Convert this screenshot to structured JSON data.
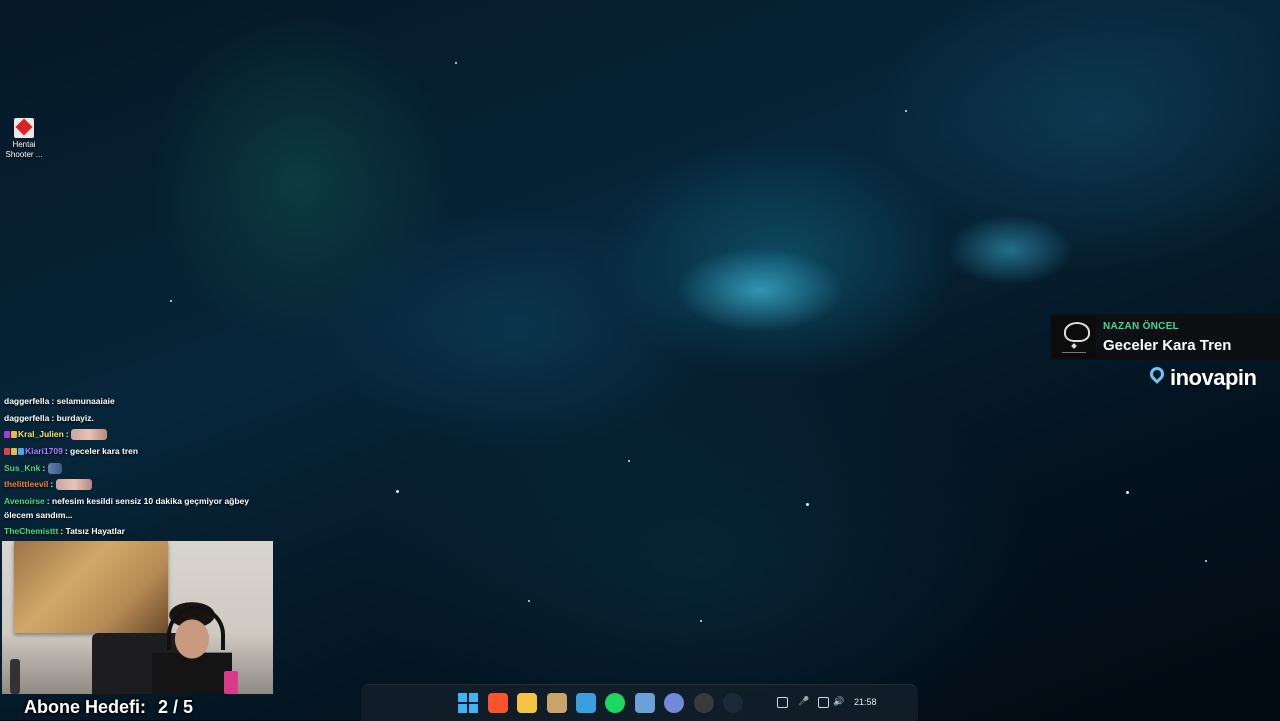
{
  "desktop": {
    "icons": [
      {
        "label": "Hentai Shooter ...",
        "icon": "game-shortcut-icon"
      }
    ]
  },
  "chat": {
    "messages": [
      {
        "user": "daggerfella",
        "user_color": "#ffffff",
        "text": "selamunaaiaie",
        "badges": [],
        "emote": null
      },
      {
        "user": "daggerfella",
        "user_color": "#ffffff",
        "text": "burdayiz.",
        "badges": [],
        "emote": null
      },
      {
        "user": "Kral_Julien",
        "user_color": "#f5e663",
        "text": "",
        "badges": [
          "#a83ad8",
          "#e8b84a"
        ],
        "emote": "emote-wide"
      },
      {
        "user": "Kiari1709",
        "user_color": "#b07cff",
        "text": "geceler kara tren",
        "badges": [
          "#e04545",
          "#e8b84a",
          "#4aa8e8"
        ],
        "emote": null
      },
      {
        "user": "Sus_Knk",
        "user_color": "#3fe07a",
        "text": "",
        "badges": [],
        "emote": "emote-small"
      },
      {
        "user": "thelittleevil",
        "user_color": "#ff7a2e",
        "text": "",
        "badges": [],
        "emote": "emote-wide"
      },
      {
        "user": "Avenoirse",
        "user_color": "#3fe07a",
        "text": "nefesim kesildi sensiz 10 dakika geçmiyor ağbey",
        "badges": [],
        "emote": null
      },
      {
        "user": "",
        "user_color": "#ffffff",
        "text": "ölecem sandım...",
        "badges": [],
        "emote": null
      },
      {
        "user": "TheChemisttt",
        "user_color": "#3fe07a",
        "text": "Tatsız Hayatlar",
        "badges": [],
        "emote": null
      }
    ]
  },
  "subscriber_goal": {
    "label": "Abone Hedefi:",
    "value": "2 / 5"
  },
  "now_playing": {
    "artist": "NAZAN ÖNCEL",
    "title": "Geceler Kara Tren"
  },
  "sponsor": {
    "name": "inovapin"
  },
  "taskbar": {
    "apps": [
      {
        "name": "windows-start-icon"
      },
      {
        "name": "brave-browser-icon",
        "color": "#fb542b"
      },
      {
        "name": "file-explorer-icon",
        "color": "#f4c542"
      },
      {
        "name": "pickaxe-tool-icon",
        "color": "#c9a46a"
      },
      {
        "name": "photos-icon",
        "color": "#3a9fe0"
      },
      {
        "name": "spotify-icon",
        "color": "#1ed760"
      },
      {
        "name": "app-grid-icon",
        "color": "#6ba0d8"
      },
      {
        "name": "discord-icon",
        "color": "#7289da"
      },
      {
        "name": "obs-studio-icon",
        "color": "#3a3a3a"
      },
      {
        "name": "steam-icon",
        "color": "#1b2838"
      }
    ],
    "tray": {
      "clock": "21:58"
    }
  }
}
